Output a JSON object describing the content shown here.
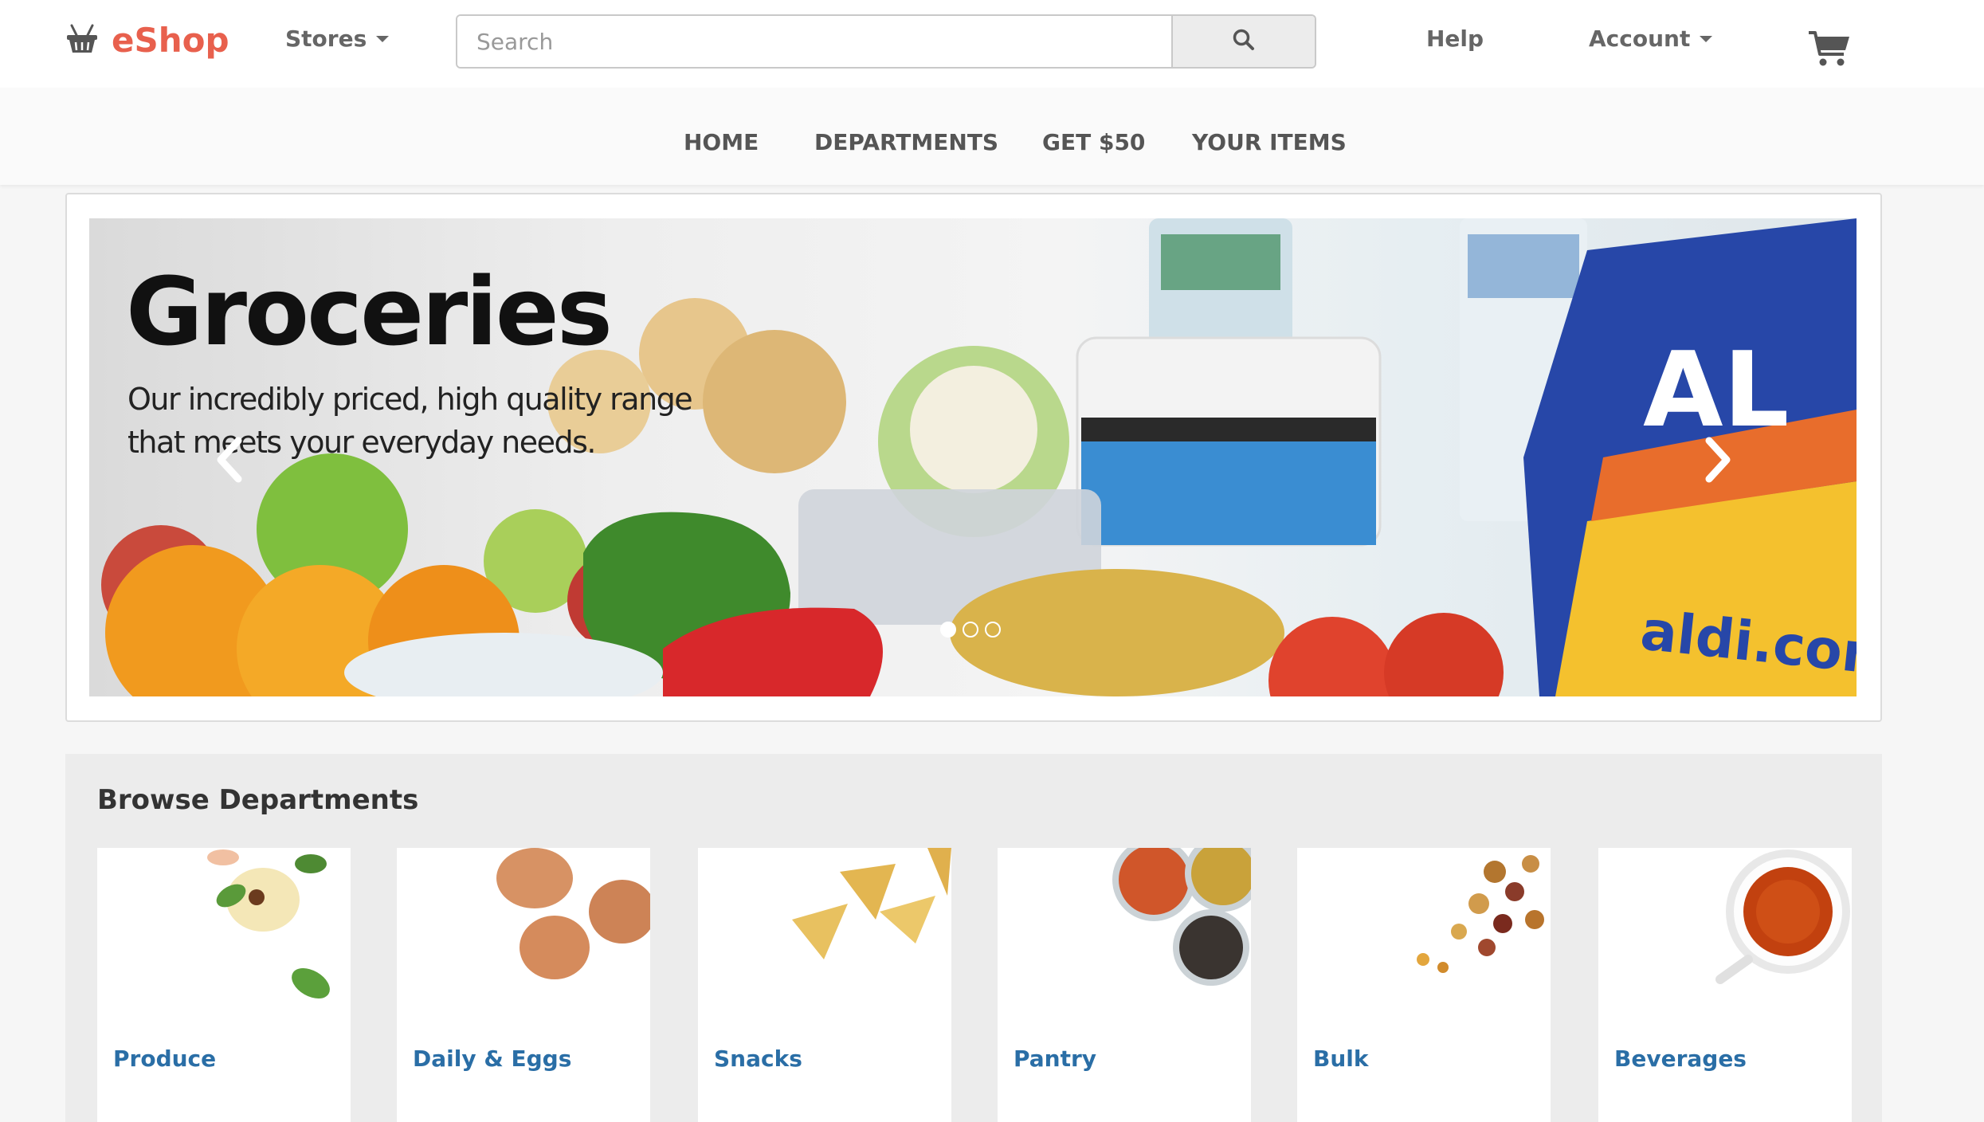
{
  "header": {
    "logo_text": "eShop",
    "stores_label": "Stores",
    "search_placeholder": "Search",
    "help_label": "Help",
    "account_label": "Account"
  },
  "main_nav": [
    "HOME",
    "DEPARTMENTS",
    "GET $50",
    "YOUR ITEMS"
  ],
  "hero": {
    "title": "Groceries",
    "subtitle": "Our incredibly priced, high quality range that meets your everyday needs.",
    "brand_text": "aldi.com",
    "slides": 3,
    "active_slide": 1
  },
  "browse": {
    "title": "Browse Departments",
    "departments": [
      "Produce",
      "Daily & Eggs",
      "Snacks",
      "Pantry",
      "Bulk",
      "Beverages"
    ]
  },
  "colors": {
    "brand": "#e8604d",
    "dept_link": "#2a6ea6",
    "nav_text": "#555555"
  },
  "icons": [
    "basket-icon",
    "search-icon",
    "cart-icon",
    "chevron-left-icon",
    "chevron-right-icon"
  ]
}
